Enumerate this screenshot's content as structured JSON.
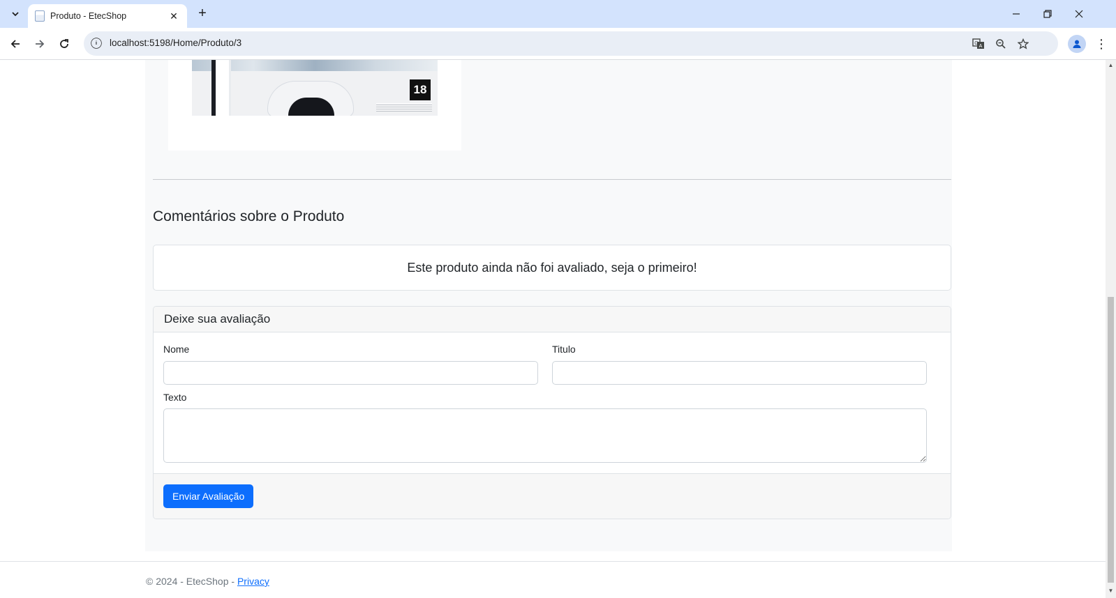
{
  "browser": {
    "tab_title": "Produto - EtecShop",
    "url": "localhost:5198/Home/Produto/3"
  },
  "product_image": {
    "age_rating": "18"
  },
  "comments": {
    "heading": "Comentários sobre o Produto",
    "empty_message": "Este produto ainda não foi avaliado, seja o primeiro!"
  },
  "review_form": {
    "header": "Deixe sua avaliação",
    "name_label": "Nome",
    "name_value": "",
    "title_label": "Titulo",
    "title_value": "",
    "text_label": "Texto",
    "text_value": "",
    "submit_label": "Enviar Avaliação",
    "submit_color": "#0d6efd"
  },
  "footer": {
    "copyright": "© 2024 - EtecShop - ",
    "privacy_link": "Privacy"
  }
}
